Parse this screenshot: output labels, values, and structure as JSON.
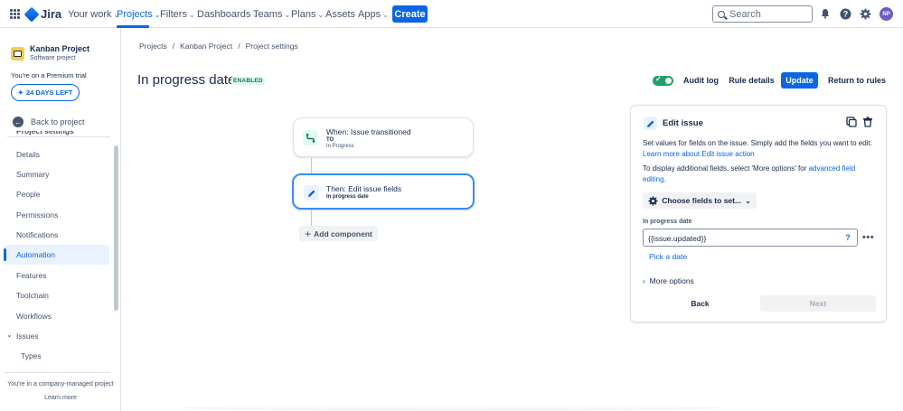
{
  "topnav": {
    "app_name": "Jira",
    "items": [
      {
        "label": "Your work"
      },
      {
        "label": "Projects"
      },
      {
        "label": "Filters"
      },
      {
        "label": "Dashboards"
      },
      {
        "label": "Teams"
      },
      {
        "label": "Plans"
      },
      {
        "label": "Assets"
      },
      {
        "label": "Apps"
      }
    ],
    "create_label": "Create",
    "search_placeholder": "Search",
    "avatar_initials": "NP"
  },
  "sidebar": {
    "project_name": "Kanban Project",
    "project_type": "Software project",
    "trial_text": "You're on a Premium trial",
    "days_left": "24 DAYS LEFT",
    "back_label": "Back to project",
    "section_title": "Project settings",
    "items": [
      {
        "label": "Details"
      },
      {
        "label": "Summary"
      },
      {
        "label": "People"
      },
      {
        "label": "Permissions"
      },
      {
        "label": "Notifications"
      },
      {
        "label": "Automation"
      },
      {
        "label": "Features"
      },
      {
        "label": "Toolchain"
      },
      {
        "label": "Workflows"
      },
      {
        "label": "Issues"
      },
      {
        "label": "Types"
      }
    ],
    "footer_text": "You're in a company-managed project",
    "footer_link": "Learn more"
  },
  "breadcrumb": [
    "Projects",
    "Kanban Project",
    "Project settings"
  ],
  "rule": {
    "title": "In progress date",
    "status_badge": "ENABLED",
    "enabled": true,
    "audit_log": "Audit log",
    "rule_details": "Rule details",
    "update": "Update",
    "return": "Return to rules"
  },
  "flow": {
    "trigger_title": "When: Issue transitioned",
    "trigger_sub1": "TO",
    "trigger_sub2": "In Progress",
    "action_title": "Then: Edit issue fields",
    "action_sub": "In progress date",
    "add_component": "Add component"
  },
  "panel": {
    "title": "Edit issue",
    "desc_text": "Set values for fields on the issue. Simply add the fields you want to edit.",
    "desc_link": "Learn more about Edit issue action",
    "display_text": "To display additional fields, select 'More options' for",
    "display_link": "advanced field editing",
    "display_end": ".",
    "choose_fields": "Choose fields to set...",
    "field_label": "In progress date",
    "field_value": "{{issue.updated}}",
    "pick_date": "Pick a date",
    "more_options": "More options",
    "back": "Back",
    "next": "Next"
  },
  "colors": {
    "primary": "#0C66E4",
    "success": "#22A06B",
    "text": "#172B4D"
  }
}
